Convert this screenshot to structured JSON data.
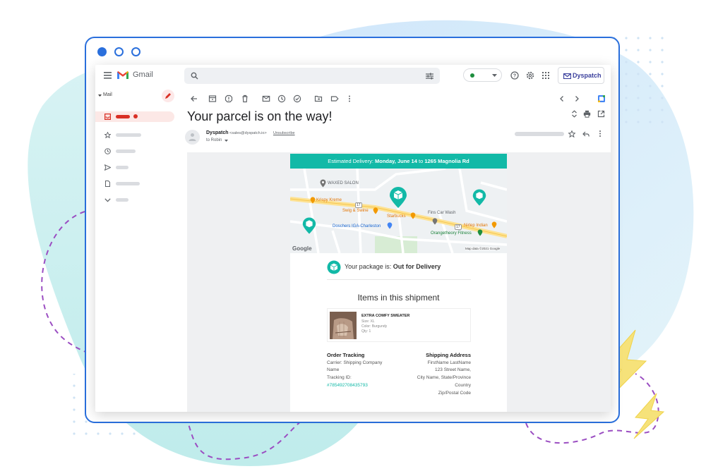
{
  "brand": {
    "product_name": "Gmail",
    "sender_logo_text": "Dyspatch",
    "primary_color": "#1a73e8",
    "teal": "#12b9a7"
  },
  "sidebar": {
    "compose_label": "Mail",
    "icons": [
      "inbox-icon",
      "star-icon",
      "clock-icon",
      "send-icon",
      "file-icon",
      "chevron-down-icon"
    ]
  },
  "email": {
    "subject": "Your parcel is on the way!",
    "sender_name": "Dyspatch",
    "sender_email": "<sales@dyspatch.io>",
    "unsubscribe": "Unsubscribe",
    "to_line": "to Robin"
  },
  "banner": {
    "prefix": "Estimated Delivery:",
    "date": "Monday, June 14",
    "to": "to",
    "address": "1265 Magnolia Rd"
  },
  "map": {
    "labels": {
      "waxed_salon": "WAXED SALON",
      "krispy_kreme": "Krispy Kreme",
      "swig_swine": "Swig & Swine",
      "starbucks": "Starbucks",
      "fins_car_wash": "Fins Car Wash",
      "nirlep_indian": "Nirlep Indian",
      "orangetheory": "Orangetheory Fitness",
      "doschers": "Doschers IGA-Charleston",
      "google": "Google",
      "map_data": "Map data ©2021 Google",
      "route_17a": "17",
      "route_17b": "17"
    }
  },
  "status": {
    "prefix": "Your package is:",
    "value": "Out for Delivery"
  },
  "items": {
    "heading": "Items in this shipment",
    "list": [
      {
        "name": "EXTRA COMFY SWEATER",
        "size": "Size: XL",
        "color": "Color: Burgundy",
        "qty": "Qty: 1"
      }
    ]
  },
  "tracking": {
    "heading": "Order Tracking",
    "carrier": "Carrier: Shipping Company",
    "carrier_cont": "Name",
    "tracking_label": "Tracking ID:",
    "tracking_id": "#785492708435793"
  },
  "shipping": {
    "heading": "Shipping Address",
    "name": "FirstName LastName",
    "street": "123 Street Name,",
    "city": "City Name, State/Province",
    "country": "Country",
    "zip": "Zip/Postal Code"
  }
}
